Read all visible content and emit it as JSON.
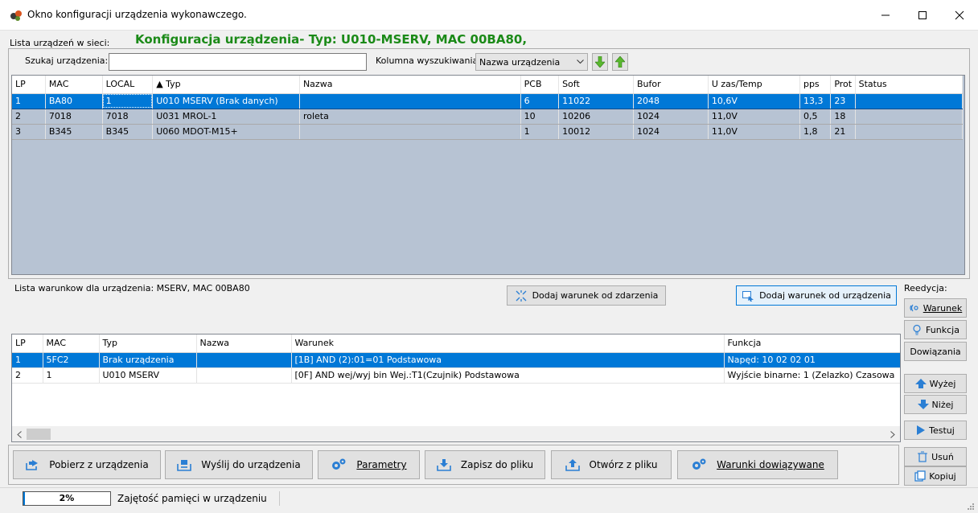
{
  "window": {
    "title": "Okno konfiguracji urządzenia wykonawczego."
  },
  "header": {
    "device_list_label": "Lista urządzeń w sieci:",
    "config_heading": "Konfiguracja urządzenia- Typ: U010-MSERV, MAC 00BA80,"
  },
  "search": {
    "label": "Szukaj urządzenia:",
    "value": "",
    "column_label": "Kolumna wyszukiwania:",
    "column_value": "Nazwa urządzenia"
  },
  "devices": {
    "columns": [
      "LP",
      "MAC",
      "LOCAL",
      "▲ Typ",
      "Nazwa",
      "PCB",
      "Soft",
      "Bufor",
      "U zas/Temp",
      "pps",
      "Prot",
      "Status"
    ],
    "rows": [
      {
        "lp": "1",
        "mac": "BA80",
        "local": "1",
        "typ": "U010 MSERV (Brak danych)",
        "nazwa": "",
        "pcb": "6",
        "soft": "11022",
        "bufor": "2048",
        "u": "10,6V",
        "pps": "13,3",
        "prot": "23",
        "status": ""
      },
      {
        "lp": "2",
        "mac": "7018",
        "local": "7018",
        "typ": "U031 MROL-1",
        "nazwa": "roleta",
        "pcb": "10",
        "soft": "10206",
        "bufor": "1024",
        "u": "11,0V",
        "pps": "0,5",
        "prot": "18",
        "status": ""
      },
      {
        "lp": "3",
        "mac": "B345",
        "local": "B345",
        "typ": "U060 MDOT-M15+",
        "nazwa": "",
        "pcb": "1",
        "soft": "10012",
        "bufor": "1024",
        "u": "11,0V",
        "pps": "1,8",
        "prot": "21",
        "status": ""
      }
    ]
  },
  "conditions": {
    "label": "Lista warunkow dla urządzenia: MSERV, MAC 00BA80",
    "add_event_button": "Dodaj warunek od zdarzenia",
    "add_device_button": "Dodaj warunek od urządzenia",
    "columns": [
      "LP",
      "MAC",
      "Typ",
      "Nazwa",
      "Warunek",
      "Funkcja"
    ],
    "rows": [
      {
        "lp": "1",
        "mac": "5FC2",
        "typ": "Brak urządzenia",
        "nazwa": "",
        "warunek": "[1B] AND (2):01=01  Podstawowa",
        "funkcja": "Napęd: 10 02 02 01"
      },
      {
        "lp": "2",
        "mac": "1",
        "typ": "U010 MSERV",
        "nazwa": "",
        "warunek": "[0F] AND  wej/wyj bin Wej.:T1(Czujnik)  Podstawowa",
        "funkcja": "Wyjście binarne:  1 (Zelazko)  Czasowa"
      }
    ]
  },
  "side_panel": {
    "label": "Reedycja:",
    "warunek": "Warunek",
    "funkcja": "Funkcja",
    "dowiazania": "Dowiązania",
    "wyzej": "Wyżej",
    "nizej": "Niżej",
    "testuj": "Testuj",
    "usun": "Usuń",
    "kopiuj": "Kopiuj"
  },
  "actions": {
    "pobierz": "Pobierz z urządzenia",
    "wyslij": "Wyślij do urządzenia",
    "parametry": "Parametry",
    "zapisz": "Zapisz do pliku",
    "otworz": "Otwórz z pliku",
    "warunki": "Warunki dowiązywane"
  },
  "status": {
    "percent": "2%",
    "memory_label": "Zajętość pamięci w urządzeniu"
  },
  "colors": {
    "selection": "#0078d7",
    "heading_green": "#1b8a18",
    "grid_empty": "#b7c3d3"
  }
}
